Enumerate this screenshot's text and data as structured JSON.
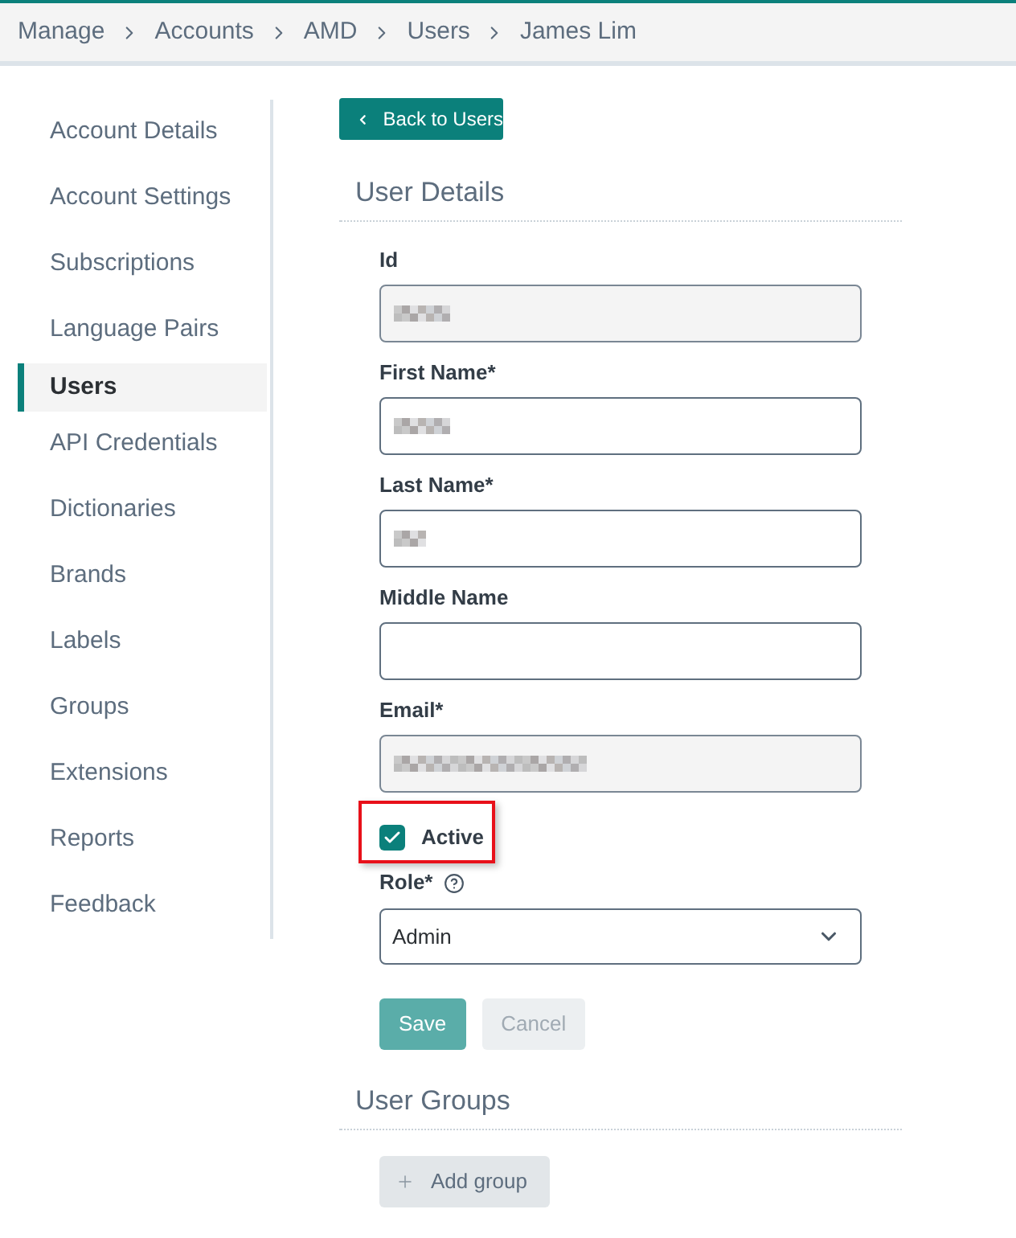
{
  "breadcrumb": [
    "Manage",
    "Accounts",
    "AMD",
    "Users",
    "James Lim"
  ],
  "sidebar": {
    "items": [
      {
        "label": "Account Details",
        "selected": false
      },
      {
        "label": "Account Settings",
        "selected": false
      },
      {
        "label": "Subscriptions",
        "selected": false
      },
      {
        "label": "Language Pairs",
        "selected": false
      },
      {
        "label": "Users",
        "selected": true
      },
      {
        "label": "API Credentials",
        "selected": false
      },
      {
        "label": "Dictionaries",
        "selected": false
      },
      {
        "label": "Brands",
        "selected": false
      },
      {
        "label": "Labels",
        "selected": false
      },
      {
        "label": "Groups",
        "selected": false
      },
      {
        "label": "Extensions",
        "selected": false
      },
      {
        "label": "Reports",
        "selected": false
      },
      {
        "label": "Feedback",
        "selected": false
      }
    ]
  },
  "back_button": {
    "label": "Back to Users"
  },
  "user_details": {
    "title": "User Details",
    "fields": [
      {
        "label": "Id",
        "disabled": true,
        "kind": "redacted_short"
      },
      {
        "label": "First Name*",
        "disabled": false,
        "kind": "redacted_short"
      },
      {
        "label": "Last Name*",
        "disabled": false,
        "kind": "redacted_tiny"
      },
      {
        "label": "Middle Name",
        "disabled": false,
        "kind": "empty"
      },
      {
        "label": "Email*",
        "disabled": true,
        "kind": "redacted_long"
      }
    ],
    "active": {
      "label": "Active",
      "checked": true,
      "highlighted": true
    },
    "role": {
      "label": "Role*",
      "value": "Admin"
    },
    "buttons": [
      {
        "label": "Save",
        "kind": "primary",
        "disabled": true
      },
      {
        "label": "Cancel",
        "kind": "secondary",
        "disabled": true
      }
    ]
  },
  "user_groups": {
    "title": "User Groups",
    "add_button": {
      "label": "Add group"
    }
  }
}
